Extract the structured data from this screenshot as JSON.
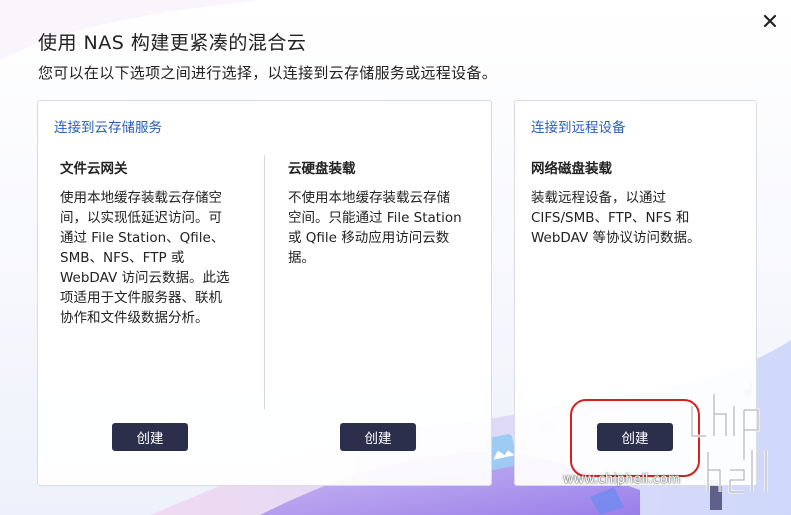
{
  "dialog": {
    "title": "使用 NAS 构建更紧凑的混合云",
    "subtitle": "您可以在以下选项之间进行选择，以连接到云存储服务或远程设备。",
    "close_icon": "close-icon"
  },
  "cloud_panel": {
    "title": "连接到云存储服务",
    "options": [
      {
        "title": "文件云网关",
        "lines": [
          "使用本地缓存装载云存储空",
          "间，以实现低延迟访问。可",
          "通过 File Station、Qfile、",
          "SMB、NFS、FTP 或",
          "WebDAV 访问云数据。此选",
          "项适用于文件服务器、联机",
          "协作和文件级数据分析。"
        ],
        "button": "创建"
      },
      {
        "title": "云硬盘装载",
        "lines": [
          "不使用本地缓存装载云存储",
          "空间。只能通过 File Station",
          "或 Qfile 移动应用访问云数",
          "据。"
        ],
        "button": "创建"
      }
    ]
  },
  "remote_panel": {
    "title": "连接到远程设备",
    "options": [
      {
        "title": "网络磁盘装载",
        "lines": [
          "装载远程设备，以通过",
          "CIFS/SMB、FTP、NFS 和",
          "WebDAV 等协议访问数据。"
        ],
        "button": "创建"
      }
    ]
  },
  "watermark": {
    "text": "www.chiphell.com",
    "logo": "chiphell"
  },
  "colors": {
    "accent": "#2a5eb8",
    "button_bg": "#2c2f4b",
    "highlight": "#d62020"
  }
}
